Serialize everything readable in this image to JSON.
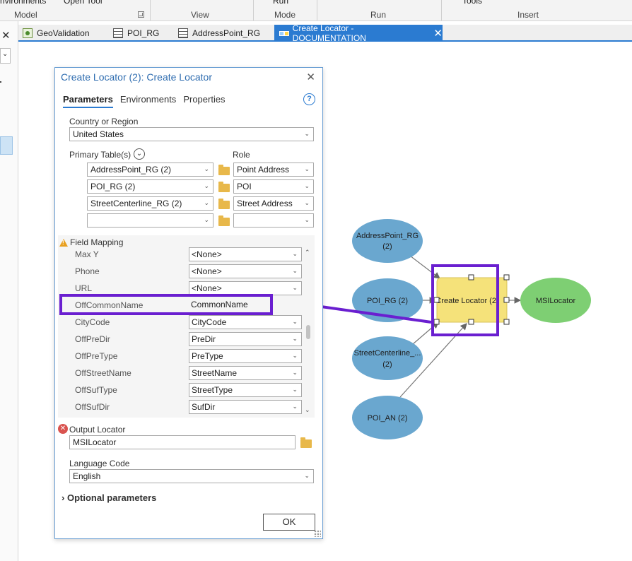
{
  "ribbon": {
    "groups": [
      "Model",
      "View",
      "Mode",
      "Run",
      "Insert"
    ],
    "cut_text": [
      "nvironments",
      "Open Tool",
      "Run",
      "Tools"
    ]
  },
  "tabs": [
    {
      "label": "GeoValidation",
      "icon": "geovalidation-icon"
    },
    {
      "label": "POI_RG",
      "icon": "table-icon"
    },
    {
      "label": "AddressPoint_RG",
      "icon": "table-icon"
    },
    {
      "label": "Create Locator - DOCUMENTATION",
      "icon": "model-icon",
      "active": true
    }
  ],
  "dialog": {
    "title": "Create Locator (2): Create Locator",
    "tabs": [
      "Parameters",
      "Environments",
      "Properties"
    ],
    "country_label": "Country or Region",
    "country_value": "United States",
    "primary_tables_label": "Primary Table(s)",
    "role_label": "Role",
    "primary_tables": [
      {
        "table": "AddressPoint_RG (2)",
        "role": "Point Address"
      },
      {
        "table": "POI_RG (2)",
        "role": "POI"
      },
      {
        "table": "StreetCenterline_RG (2)",
        "role": "Street Address"
      },
      {
        "table": "",
        "role": ""
      }
    ],
    "field_mapping_label": "Field Mapping",
    "field_mapping": [
      {
        "name": "Max Y",
        "value": "<None>"
      },
      {
        "name": "Phone",
        "value": "<None>"
      },
      {
        "name": "URL",
        "value": "<None>"
      },
      {
        "name": "OffCommonName",
        "value": "CommonName"
      },
      {
        "name": "CityCode",
        "value": "CityCode"
      },
      {
        "name": "OffPreDir",
        "value": "PreDir"
      },
      {
        "name": "OffPreType",
        "value": "PreType"
      },
      {
        "name": "OffStreetName",
        "value": "StreetName"
      },
      {
        "name": "OffSufType",
        "value": "StreetType"
      },
      {
        "name": "OffSufDir",
        "value": "SufDir"
      }
    ],
    "output_label": "Output Locator",
    "output_value": "MSILocator",
    "language_label": "Language Code",
    "language_value": "English",
    "optional_label": "Optional parameters",
    "ok_label": "OK"
  },
  "model": {
    "inputs": [
      "AddressPoint_RG (2)",
      "POI_RG (2)",
      "StreetCenterline_...\n(2)",
      "POI_AN (2)"
    ],
    "tool": "Create Locator (2)",
    "output": "MSILocator"
  },
  "colors": {
    "accent": "#2b7bd1",
    "highlight": "#6a1fd0",
    "input_node": "#6aa7cf",
    "tool_node": "#f5e27a",
    "output_node": "#7ecf73"
  }
}
